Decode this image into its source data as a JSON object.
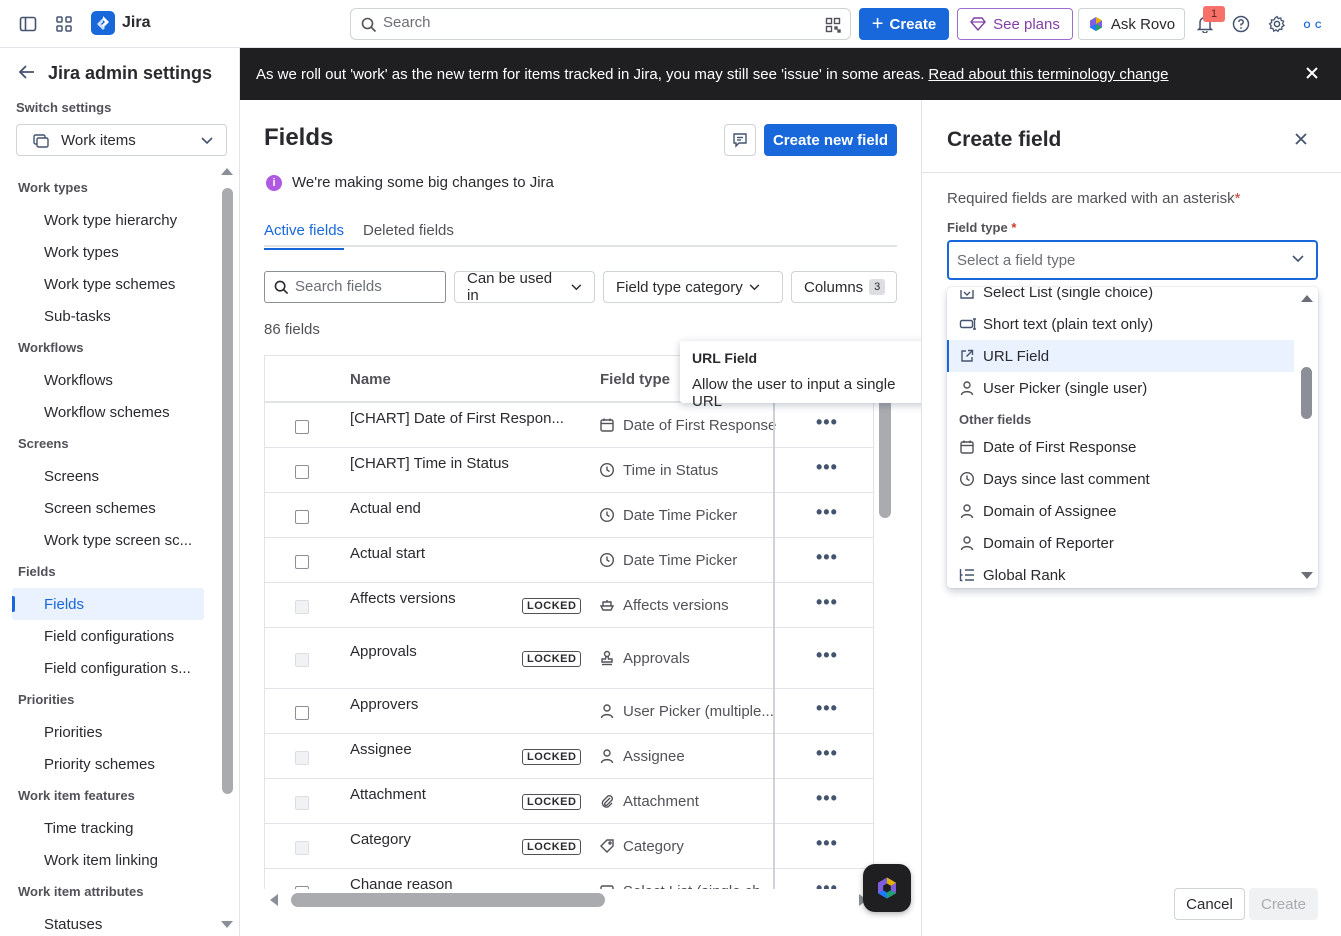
{
  "topnav": {
    "app_name": "Jira",
    "search_placeholder": "Search",
    "create_label": "Create",
    "see_plans_label": "See plans",
    "ask_rovo_label": "Ask Rovo",
    "notification_count": "1",
    "avatar_initials": "O C",
    "colors": {
      "primary": "#1868db",
      "plans": "#803fa5"
    }
  },
  "sidebar": {
    "title": "Jira admin settings",
    "switch_label": "Switch settings",
    "switch_value": "Work items",
    "sections": [
      {
        "title": "Work types",
        "items": [
          "Work type hierarchy",
          "Work types",
          "Work type schemes",
          "Sub-tasks"
        ]
      },
      {
        "title": "Workflows",
        "items": [
          "Workflows",
          "Workflow schemes"
        ]
      },
      {
        "title": "Screens",
        "items": [
          "Screens",
          "Screen schemes",
          "Work type screen sc..."
        ]
      },
      {
        "title": "Fields",
        "items": [
          "Fields",
          "Field configurations",
          "Field configuration s..."
        ]
      },
      {
        "title": "Priorities",
        "items": [
          "Priorities",
          "Priority schemes"
        ]
      },
      {
        "title": "Work item features",
        "items": [
          "Time tracking",
          "Work item linking"
        ]
      },
      {
        "title": "Work item attributes",
        "items": [
          "Statuses"
        ]
      }
    ],
    "active_item": "Fields"
  },
  "banner": {
    "text": "As we roll out 'work' as the new term for items tracked in Jira, you may still see 'issue' in some areas.",
    "link": "Read about this terminology change"
  },
  "main": {
    "title": "Fields",
    "create_button": "Create new field",
    "info_text": "We're making some big changes to Jira",
    "tabs": [
      "Active fields",
      "Deleted fields"
    ],
    "search_placeholder": "Search fields",
    "filters": {
      "used_in": "Can be used in",
      "category": "Field type category",
      "columns": "Columns",
      "columns_count": "3"
    },
    "field_count": "86 fields",
    "columns": {
      "name": "Name",
      "type": "Field type"
    },
    "locked_label": "LOCKED",
    "rows": [
      {
        "name": "[CHART] Date of First Respon...",
        "type": "Date of First Response",
        "icon": "calendar-icon",
        "locked": false
      },
      {
        "name": "[CHART] Time in Status",
        "type": "Time in Status",
        "icon": "clock-icon",
        "locked": false
      },
      {
        "name": "Actual end",
        "type": "Date Time Picker",
        "icon": "clock-icon",
        "locked": false
      },
      {
        "name": "Actual start",
        "type": "Date Time Picker",
        "icon": "clock-icon",
        "locked": false
      },
      {
        "name": "Affects versions",
        "type": "Affects versions",
        "icon": "ship-icon",
        "locked": true
      },
      {
        "name": "Approvals",
        "type": "Approvals",
        "icon": "stamp-icon",
        "locked": true
      },
      {
        "name": "Approvers",
        "type": "User Picker (multiple...",
        "icon": "person-icon",
        "locked": false
      },
      {
        "name": "Assignee",
        "type": "Assignee",
        "icon": "person-icon",
        "locked": true
      },
      {
        "name": "Attachment",
        "type": "Attachment",
        "icon": "paperclip-icon",
        "locked": true
      },
      {
        "name": "Category",
        "type": "Category",
        "icon": "tag-icon",
        "locked": true
      },
      {
        "name": "Change reason",
        "type": "Select List (single ch...",
        "icon": "list-icon",
        "locked": false
      }
    ]
  },
  "tooltip": {
    "title": "URL Field",
    "body": "Allow the user to input a single URL"
  },
  "panel": {
    "title": "Create field",
    "required_note": "Required fields are marked with an asterisk",
    "asterisk": "*",
    "field_type_label": "Field type",
    "field_type_placeholder": "Select a field type",
    "menu": {
      "items_top": [
        {
          "label": "Select List (single choice)",
          "icon": "select-icon"
        },
        {
          "label": "Short text (plain text only)",
          "icon": "short-text-icon"
        },
        {
          "label": "URL Field",
          "icon": "link-external-icon",
          "selected": true
        },
        {
          "label": "User Picker (single user)",
          "icon": "person-icon"
        }
      ],
      "group_label": "Other fields",
      "items_other": [
        {
          "label": "Date of First Response",
          "icon": "calendar-icon"
        },
        {
          "label": "Days since last comment",
          "icon": "clock-icon"
        },
        {
          "label": "Domain of Assignee",
          "icon": "person-icon"
        },
        {
          "label": "Domain of Reporter",
          "icon": "person-icon"
        },
        {
          "label": "Global Rank",
          "icon": "rank-icon"
        }
      ]
    },
    "cancel_label": "Cancel",
    "create_label": "Create"
  }
}
